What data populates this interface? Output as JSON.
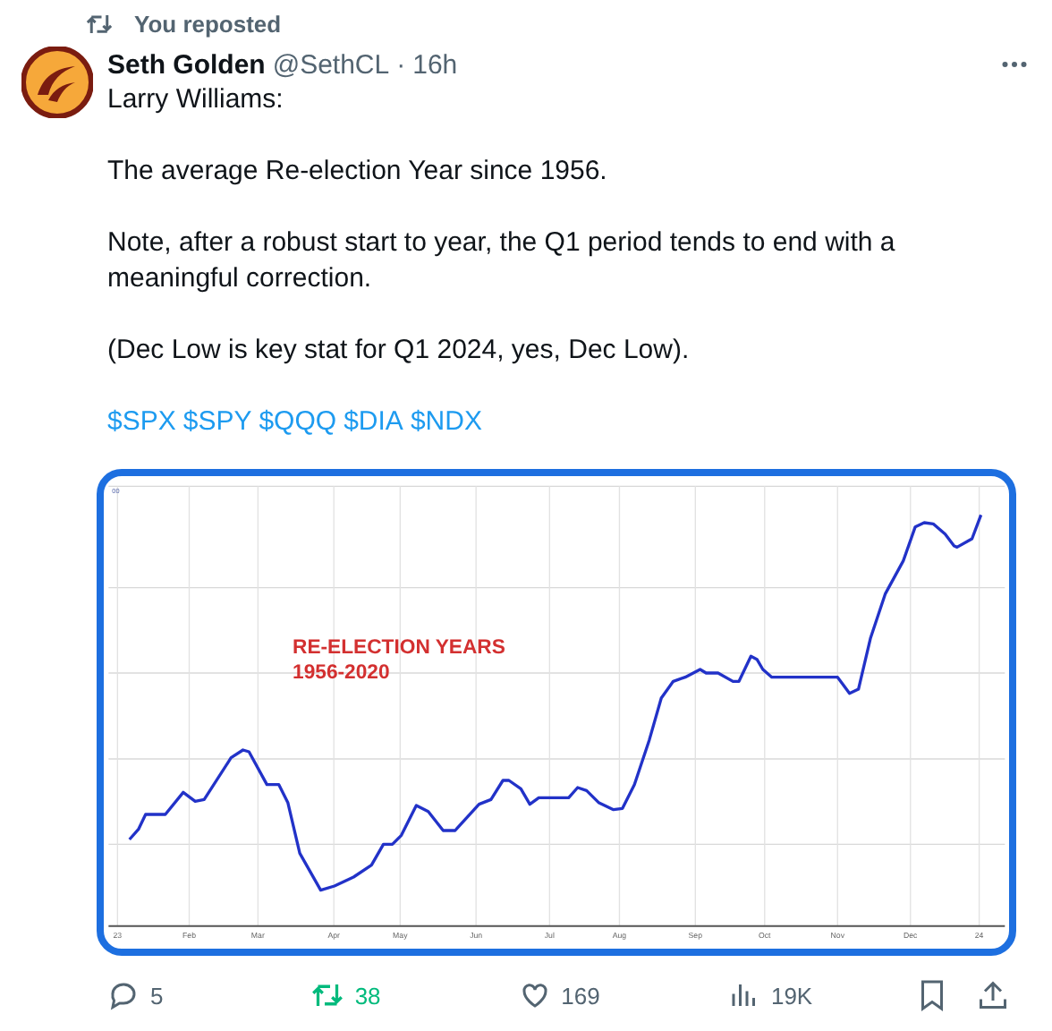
{
  "repost_banner": {
    "text": "You reposted"
  },
  "post": {
    "author": {
      "name": "Seth Golden",
      "handle": "@SethCL",
      "separator": "·",
      "time": "16h"
    },
    "paragraphs": [
      "Larry Williams:",
      "The average Re-election Year since 1956.",
      "Note, after a robust start to year, the Q1 period tends to end with a meaningful correction.",
      "(Dec Low is key stat for Q1 2024, yes, Dec Low)."
    ],
    "cashtags": [
      "$SPX",
      "$SPY",
      "$QQQ",
      "$DIA",
      "$NDX"
    ],
    "chart": {
      "corner_label": "00",
      "title_lines": [
        "RE-ELECTION YEARS",
        "1956-2020"
      ],
      "x_labels": [
        "23",
        "Feb",
        "Mar",
        "Apr",
        "May",
        "Jun",
        "Jul",
        "Aug",
        "Sep",
        "Oct",
        "Nov",
        "Dec",
        "24"
      ]
    },
    "actions": [
      {
        "kind": "reply",
        "count": "5",
        "active": false
      },
      {
        "kind": "repost",
        "count": "38",
        "active": true
      },
      {
        "kind": "like",
        "count": "169",
        "active": false
      },
      {
        "kind": "views",
        "count": "19K"
      },
      {
        "kind": "bookmark"
      },
      {
        "kind": "share"
      }
    ]
  }
}
